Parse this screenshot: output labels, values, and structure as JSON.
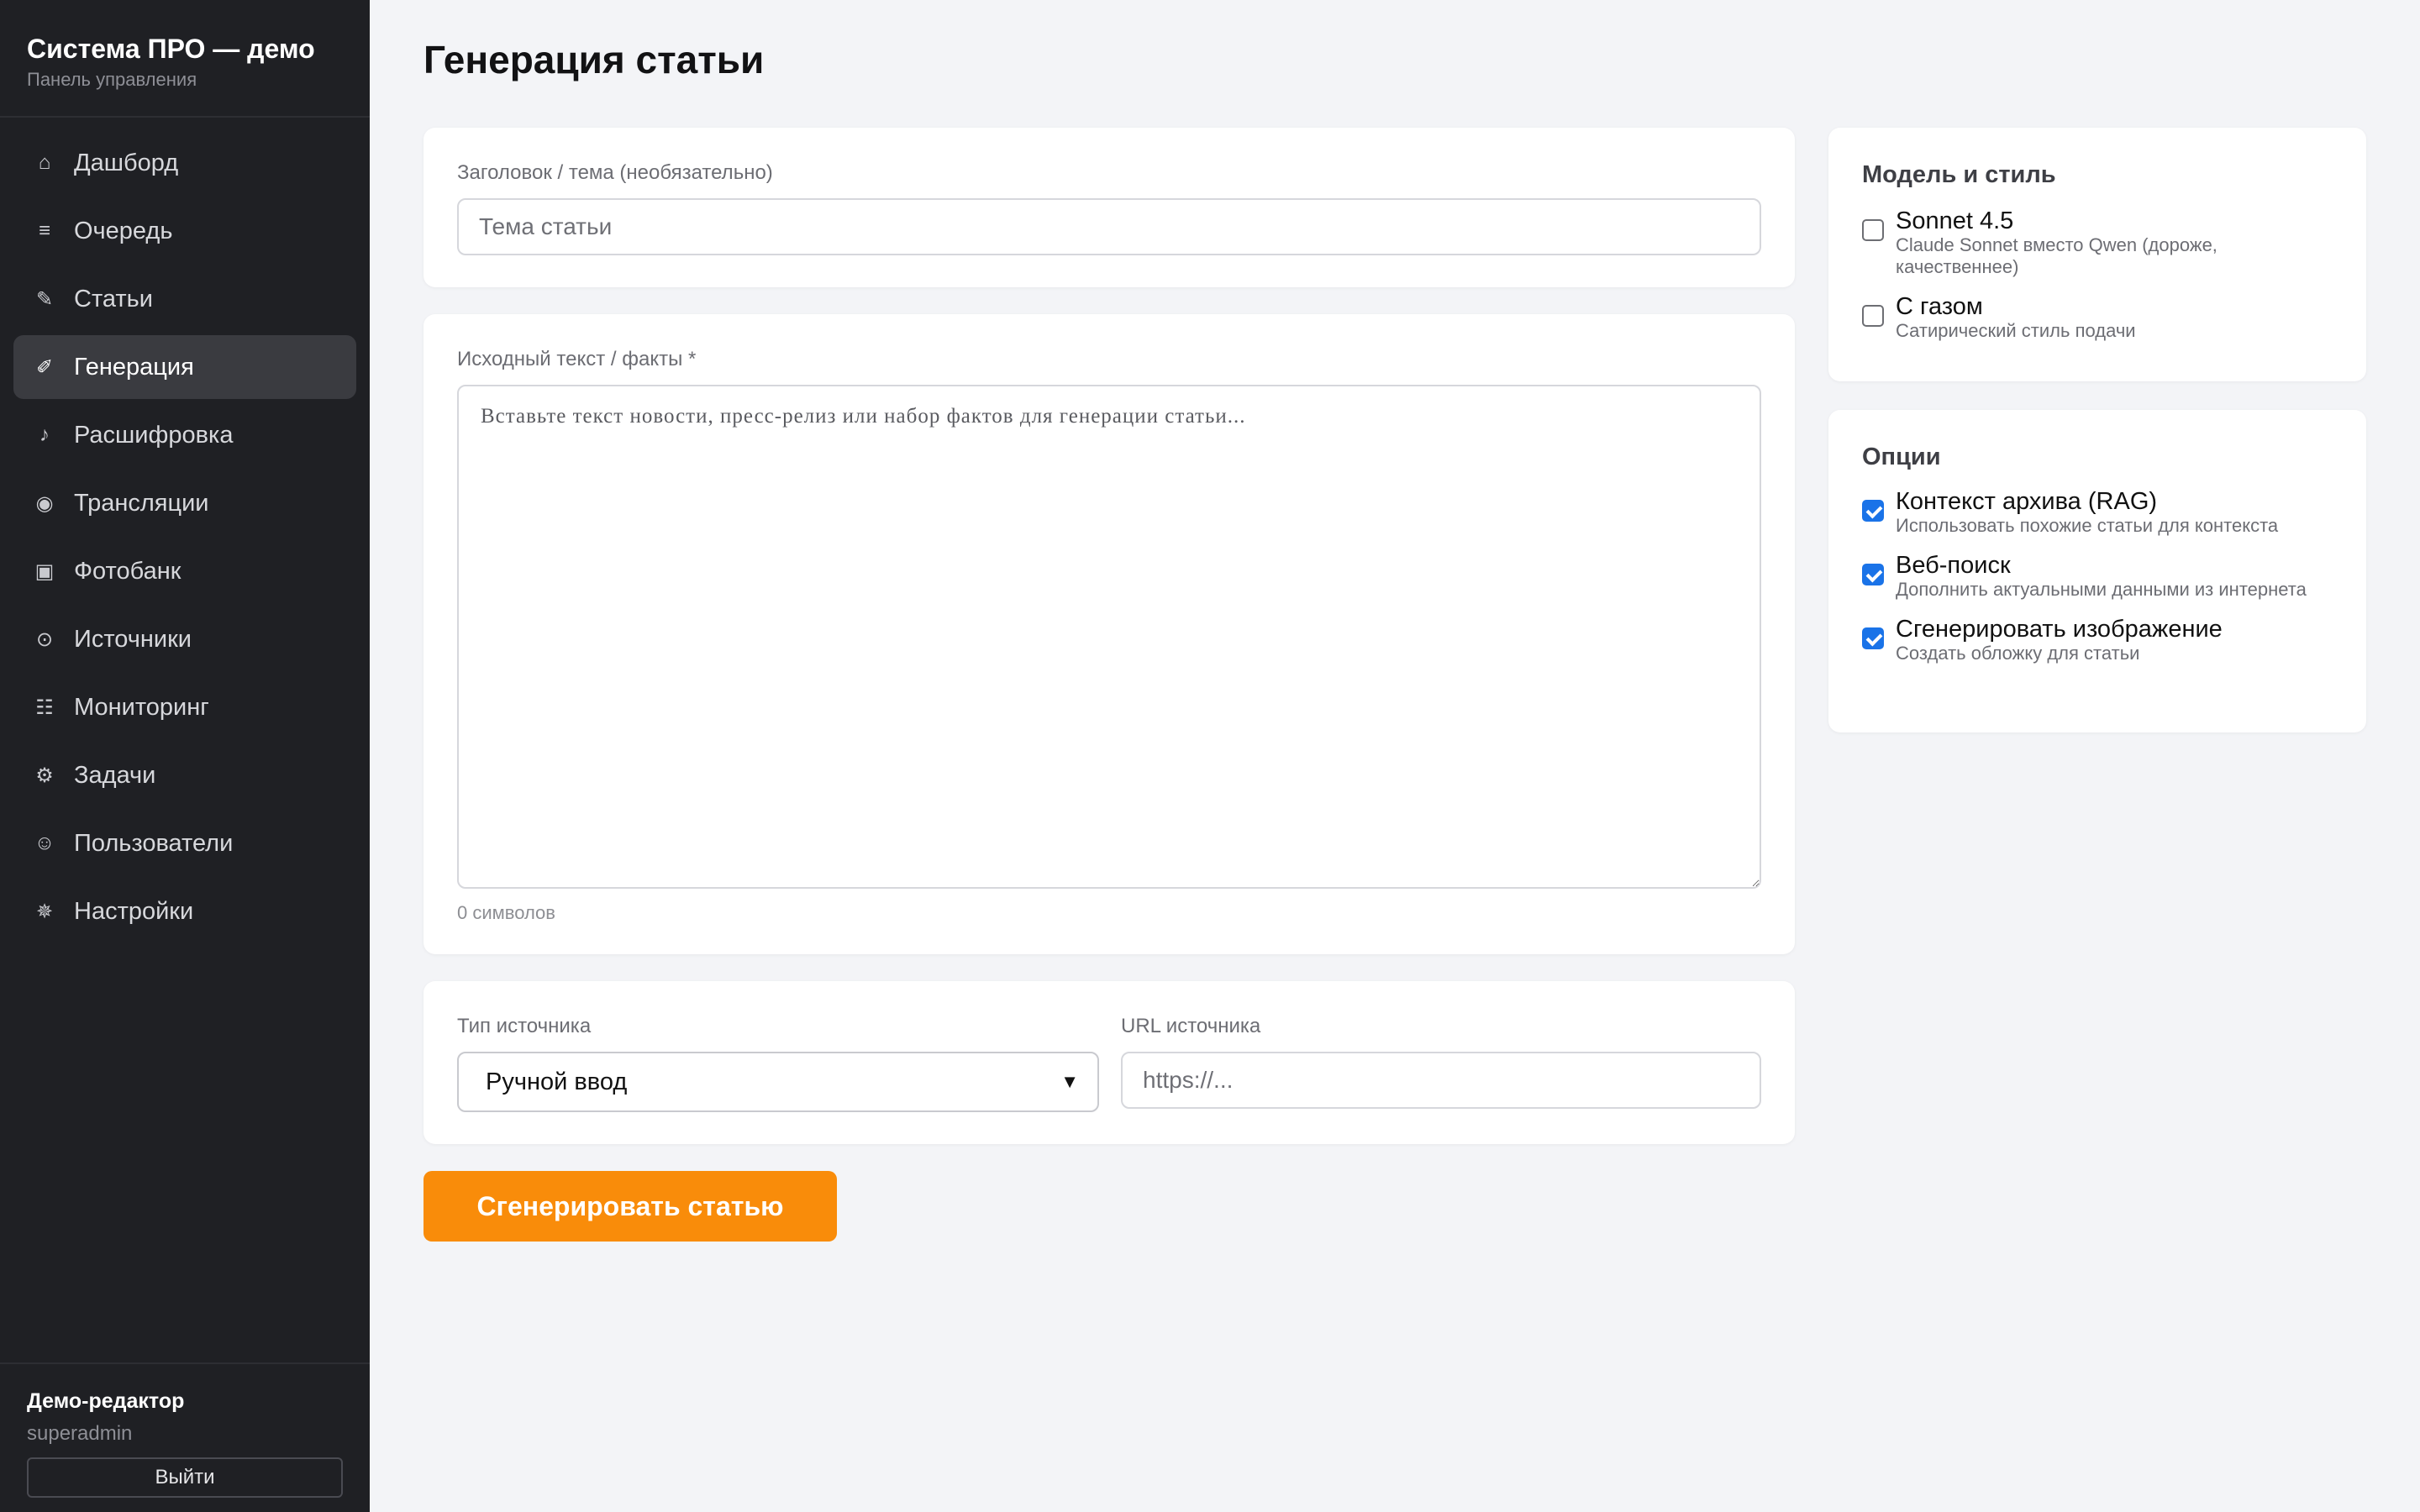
{
  "sidebar": {
    "brand_title": "Система ПРО — демо",
    "brand_subtitle": "Панель управления",
    "items": [
      {
        "icon": "⌂",
        "label": "Дашборд"
      },
      {
        "icon": "≡",
        "label": "Очередь"
      },
      {
        "icon": "✎",
        "label": "Статьи"
      },
      {
        "icon": "✐",
        "label": "Генерация",
        "active": true
      },
      {
        "icon": "♪",
        "label": "Расшифровка"
      },
      {
        "icon": "◉",
        "label": "Трансляции"
      },
      {
        "icon": "▣",
        "label": "Фотобанк"
      },
      {
        "icon": "⊙",
        "label": "Источники"
      },
      {
        "icon": "☷",
        "label": "Мониторинг"
      },
      {
        "icon": "⚙",
        "label": "Задачи"
      },
      {
        "icon": "☺",
        "label": "Пользователи"
      },
      {
        "icon": "✵",
        "label": "Настройки"
      }
    ],
    "user": {
      "name": "Демо-редактор",
      "login": "superadmin",
      "logout_label": "Выйти"
    }
  },
  "main": {
    "title": "Генерация статьи",
    "topic": {
      "label": "Заголовок / тема (необязательно)",
      "placeholder": "Тема статьи",
      "value": ""
    },
    "source_text": {
      "label": "Исходный текст / факты *",
      "placeholder": "Вставьте текст новости, пресс-релиз или набор фактов для генерации статьи...",
      "value": "",
      "char_count": "0 символов"
    },
    "source_type": {
      "label": "Тип источника",
      "selected": "Ручной ввод"
    },
    "source_url": {
      "label": "URL источника",
      "placeholder": "https://...",
      "value": ""
    },
    "generate_label": "Сгенерировать статью"
  },
  "model_panel": {
    "title": "Модель и стиль",
    "options": [
      {
        "title": "Sonnet 4.5",
        "desc": "Claude Sonnet вместо Qwen (дороже, качественнее)",
        "checked": false
      },
      {
        "title": "С газом",
        "desc": "Сатирический стиль подачи",
        "checked": false
      }
    ]
  },
  "options_panel": {
    "title": "Опции",
    "options": [
      {
        "title": "Контекст архива (RAG)",
        "desc": "Использовать похожие статьи для контекста",
        "checked": true
      },
      {
        "title": "Веб-поиск",
        "desc": "Дополнить актуальными данными из интернета",
        "checked": true
      },
      {
        "title": "Сгенерировать изображение",
        "desc": "Создать обложку для статьи",
        "checked": true
      }
    ]
  },
  "colors": {
    "sidebar_bg": "#1f2024",
    "accent_button": "#f98c0a",
    "checkbox_checked": "#1a73e8",
    "page_bg": "#f3f4f7"
  }
}
